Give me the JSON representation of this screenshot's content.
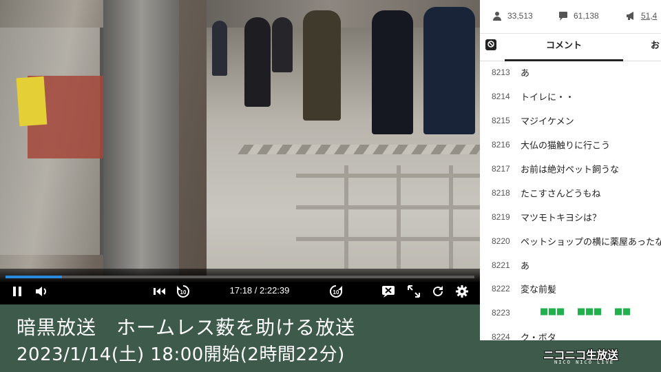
{
  "player": {
    "progress_fraction": 0.12,
    "time_display": "17:18 / 2:22:39",
    "accent_color": "#2a8ae0",
    "controls": {
      "play_pause_icon": "pause-icon",
      "volume_icon": "volume-icon",
      "skip_start_icon": "skip-start-icon",
      "rewind_icon": "rewind-10-icon",
      "forward_icon": "forward-10-icon",
      "comment_toggle_icon": "comment-off-icon",
      "fullscreen_icon": "fullscreen-icon",
      "reload_icon": "reload-icon",
      "settings_icon": "gear-icon"
    }
  },
  "banner": {
    "title": "暗黒放送　ホームレス薮を助ける放送",
    "date": "2023/1/14(土) 18:00開始(2時間22分)",
    "background": "#3d5a4a"
  },
  "stats": {
    "viewers": "33,513",
    "comments": "61,138",
    "ads": "51,4"
  },
  "tabs": {
    "comment": "コメント",
    "other": "お"
  },
  "comments": [
    {
      "no": "8213",
      "text": "あ"
    },
    {
      "no": "8214",
      "text": "トイレに・・"
    },
    {
      "no": "8215",
      "text": "マジイケメン"
    },
    {
      "no": "8216",
      "text": "大仏の猫触りに行こう"
    },
    {
      "no": "8217",
      "text": "お前は絶対ペット飼うな"
    },
    {
      "no": "8218",
      "text": "たこすさんどうもね"
    },
    {
      "no": "8219",
      "text": "マツモトキヨシは？"
    },
    {
      "no": "8220",
      "text": "ペットショップの横に薬屋あったな"
    },
    {
      "no": "8221",
      "text": "あ"
    },
    {
      "no": "8222",
      "text": "変な前髪"
    },
    {
      "no": "8223",
      "text": ""
    },
    {
      "no": "8224",
      "text": "ク・ボタ"
    }
  ],
  "logo": {
    "main": "ニコニコ生放送",
    "sub": "NICO NICO LIVE"
  }
}
